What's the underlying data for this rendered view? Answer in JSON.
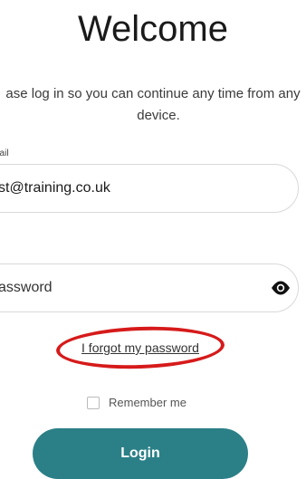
{
  "header": {
    "title": "Welcome",
    "subtitle_line1": "ase log in so you can continue any time from any",
    "subtitle_line2": "device."
  },
  "email": {
    "label": "nail",
    "value": "st@training.co.uk"
  },
  "password": {
    "placeholder": "assword",
    "toggle_icon": "eye-icon"
  },
  "forgot": {
    "label": "I forgot my password",
    "highlight_color": "#d61a1a"
  },
  "remember": {
    "label": "Remember me"
  },
  "login": {
    "label": "Login",
    "color": "#2b8087"
  }
}
